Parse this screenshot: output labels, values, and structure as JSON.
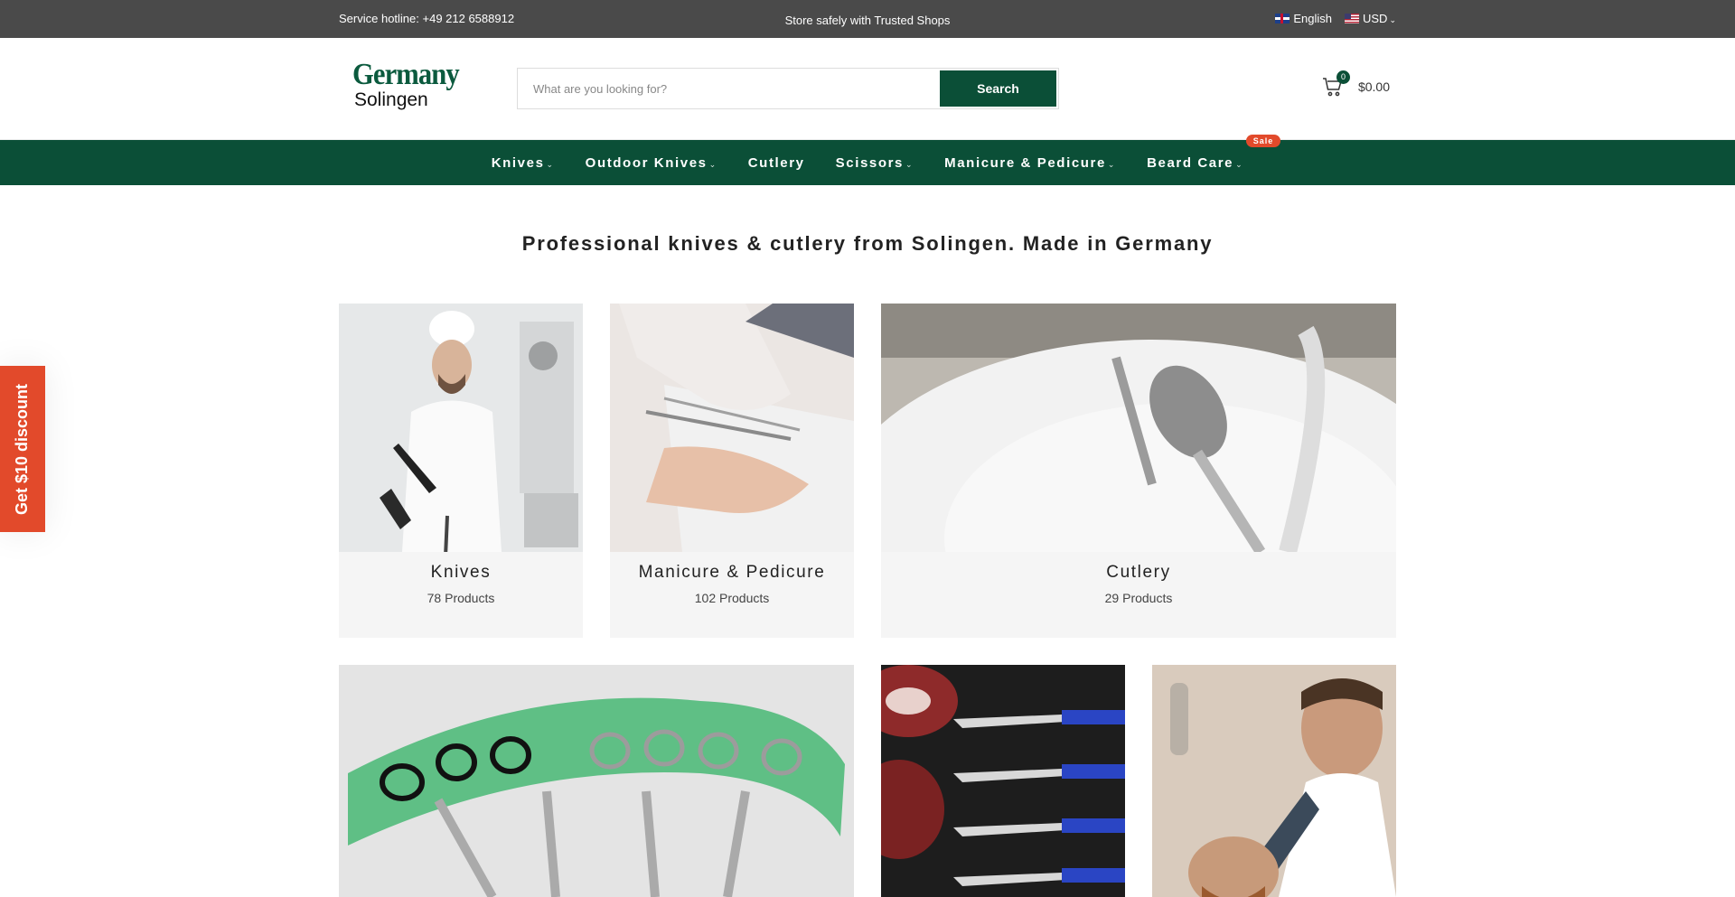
{
  "topbar": {
    "hotline": "Service hotline: +49 212 6588912",
    "trusted": "Store safely with Trusted Shops",
    "language": "English",
    "currency": "USD"
  },
  "header": {
    "logo_line1": "Germany",
    "logo_line2": "Solingen",
    "search_placeholder": "What are you looking for?",
    "search_button": "Search",
    "cart_count": "0",
    "cart_total": "$0.00"
  },
  "nav": {
    "items": [
      {
        "label": "Knives"
      },
      {
        "label": "Outdoor Knives"
      },
      {
        "label": "Cutlery"
      },
      {
        "label": "Scissors"
      },
      {
        "label": "Manicure & Pedicure"
      },
      {
        "label": "Beard Care"
      }
    ],
    "sale_badge": "Sale"
  },
  "tagline": "Professional knives & cutlery from Solingen. Made in Germany",
  "categories": [
    {
      "title": "Knives",
      "count": "78 Products"
    },
    {
      "title": "Manicure & Pedicure",
      "count": "102 Products"
    },
    {
      "title": "Cutlery",
      "count": "29 Products"
    }
  ],
  "discount_tab": "Get $10 discount",
  "colors": {
    "brand_green": "#0b4f37",
    "accent_orange": "#e24a2b",
    "topbar_gray": "#4a4a4a"
  }
}
